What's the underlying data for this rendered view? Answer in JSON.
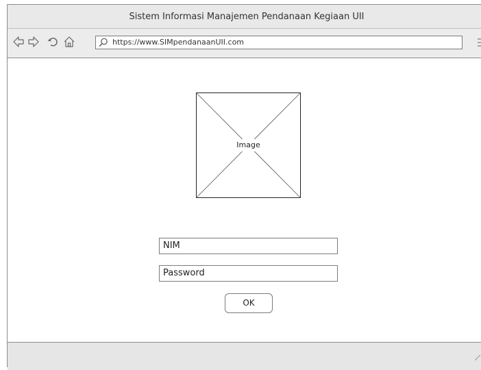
{
  "window": {
    "title": "Sistem Informasi Manajemen Pendanaan Kegiaan UII"
  },
  "toolbar": {
    "back_icon": "back-arrow-icon",
    "forward_icon": "forward-arrow-icon",
    "reload_icon": "reload-icon",
    "home_icon": "home-icon",
    "search_icon": "search-icon",
    "menu_icon": "hamburger-menu-icon",
    "url": "https://www.SIMpendanaanUII.com"
  },
  "main": {
    "image_placeholder_label": "Image",
    "nim_field": {
      "value": "NIM"
    },
    "password_field": {
      "value": "Password"
    },
    "ok_button_label": "OK"
  },
  "colors": {
    "chrome_background": "#ececec",
    "border": "#7b7b7b"
  }
}
